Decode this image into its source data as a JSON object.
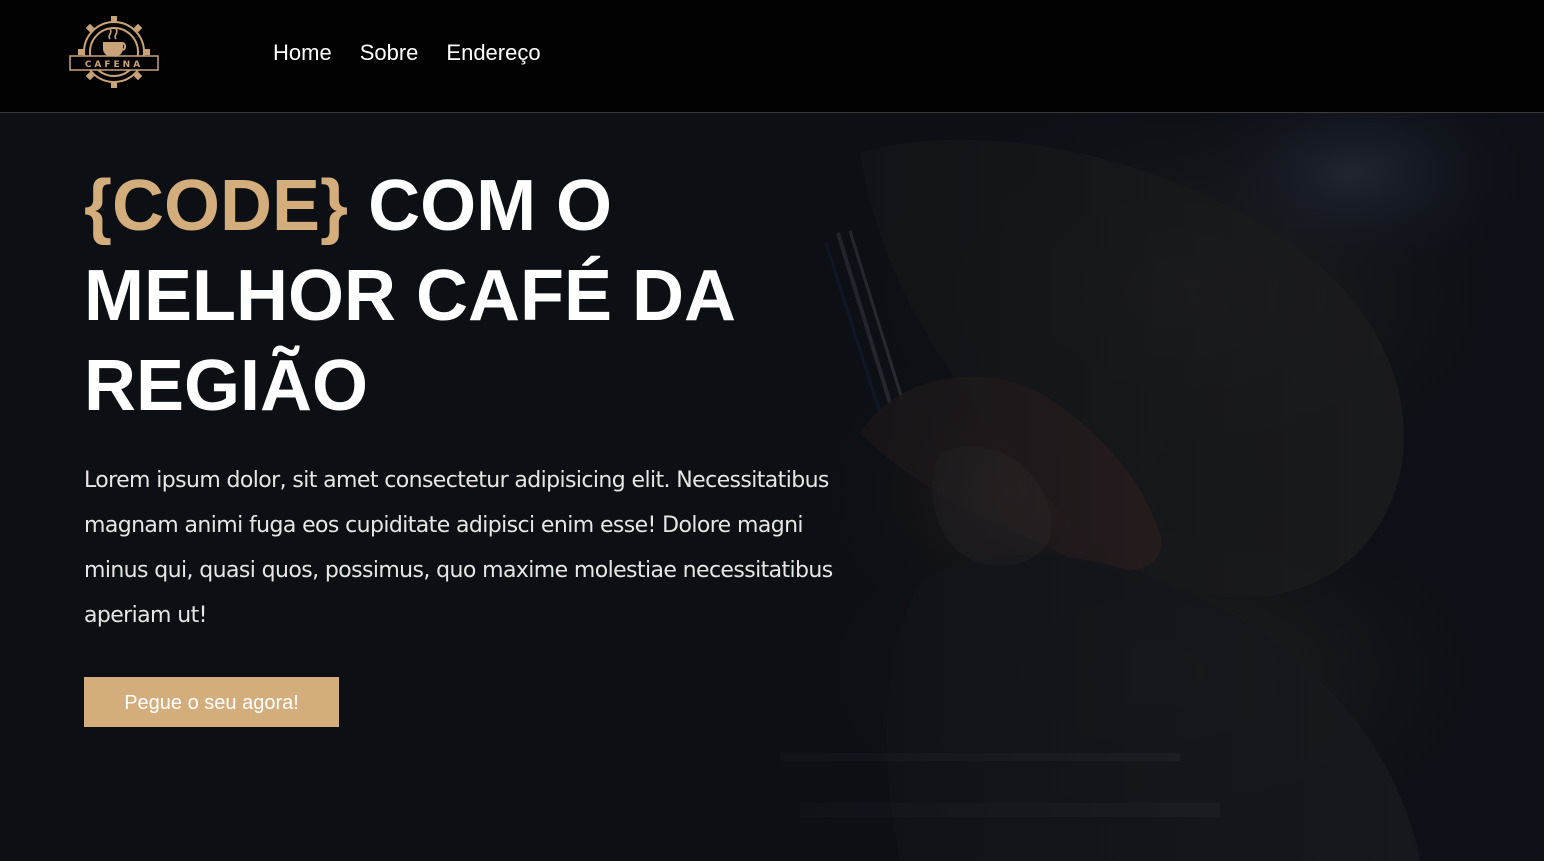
{
  "brand": {
    "logo_text": "CAFENA",
    "accent_color": "#d4ad7c"
  },
  "nav": {
    "items": [
      {
        "label": "Home"
      },
      {
        "label": "Sobre"
      },
      {
        "label": "Endereço"
      }
    ]
  },
  "hero": {
    "title_accent": "{CODE}",
    "title_rest": " COM O MELHOR CAFÉ DA REGIÃO",
    "description": "Lorem ipsum dolor, sit amet consectetur adipisicing elit. Necessitatibus magnam animi fuga eos cupiditate adipisci enim esse! Dolore magni minus qui, quasi quos, possimus, quo maxime molestiae necessitatibus aperiam ut!",
    "cta_label": "Pegue o seu agora!"
  }
}
